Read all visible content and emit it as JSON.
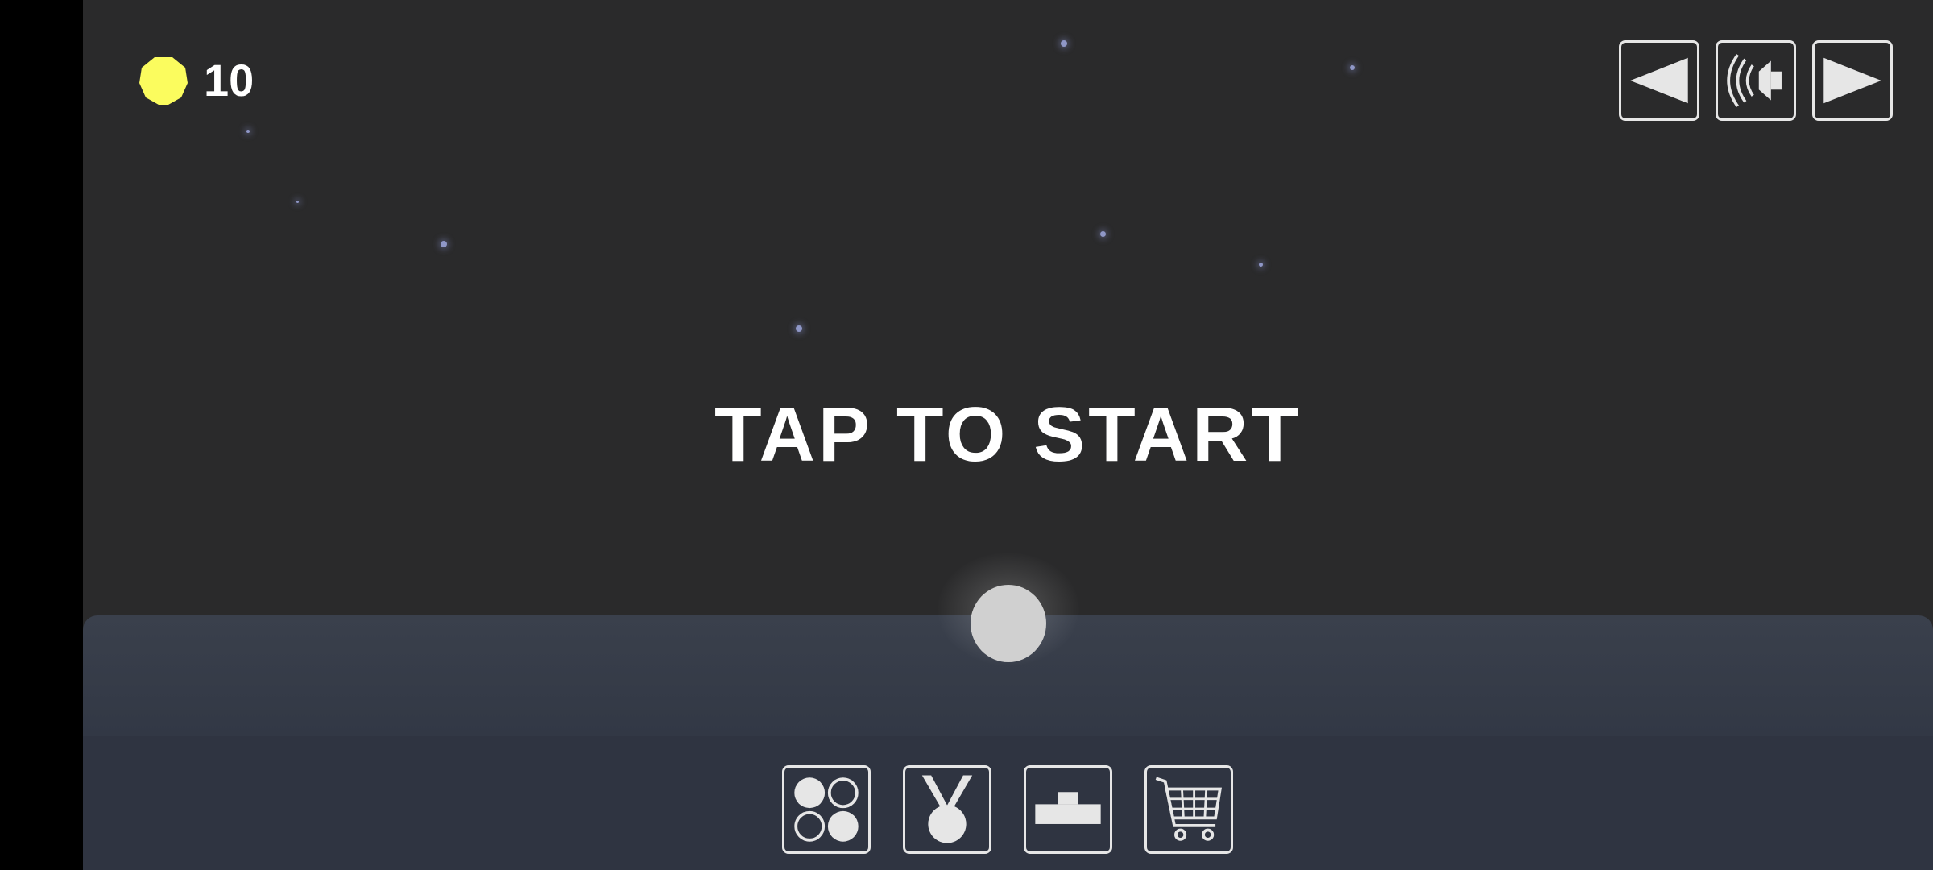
{
  "hud": {
    "coin_count": "10",
    "coin_icon": "coin-icon",
    "coin_color": "#fbfc5e"
  },
  "center": {
    "tap_text": "TAP TO START"
  },
  "top_buttons": [
    {
      "name": "previous-button",
      "icon": "triangle-left-icon"
    },
    {
      "name": "sound-button",
      "icon": "speaker-icon"
    },
    {
      "name": "next-button",
      "icon": "triangle-right-icon"
    }
  ],
  "bottom_buttons": [
    {
      "name": "ball-skins-button",
      "icon": "circles-grid-icon"
    },
    {
      "name": "achievements-button",
      "icon": "medal-icon"
    },
    {
      "name": "leaderboard-button",
      "icon": "podium-icon"
    },
    {
      "name": "shop-button",
      "icon": "shopping-cart-icon"
    }
  ],
  "colors": {
    "background": "#2a2a2b",
    "ground": "#3a404c",
    "ball": "#d0d0d0",
    "star": "#8f97c7"
  }
}
